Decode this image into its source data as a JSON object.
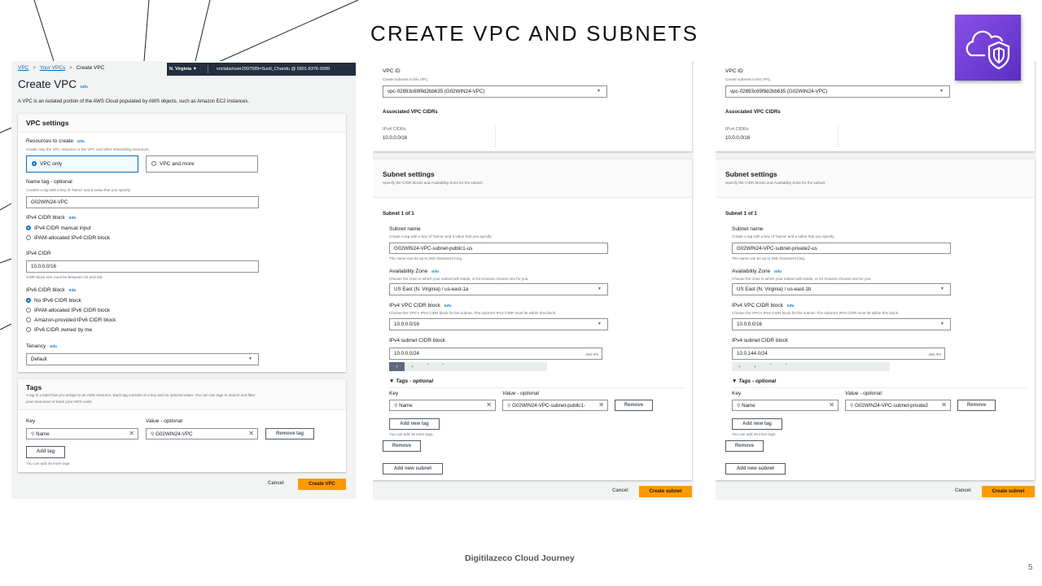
{
  "slide": {
    "title": "CREATE VPC AND SUBNETS",
    "footer": "Digitilazeco Cloud Journey",
    "page_number": "5",
    "logo_icon": "vpc-cloud-shield-icon",
    "accent": "#ff9900"
  },
  "vpc": {
    "breadcrumb": [
      "VPC",
      "Your VPCs",
      "Create VPC"
    ],
    "region": "N. Virginia ▼",
    "account": "voclabs/user2997589=Sunil_Chandu @ 5901-8376-9399",
    "title": "Create VPC",
    "info": "Info",
    "description": "A VPC is an isolated portion of the AWS Cloud populated by AWS objects, such as Amazon EC2 instances.",
    "settings_title": "VPC settings",
    "resources_label": "Resources to create",
    "resources_help": "Create only the VPC resource or the VPC and other networking resources.",
    "resource_options": [
      "VPC only",
      "VPC and more"
    ],
    "name_tag_label": "Name tag - optional",
    "name_tag_help": "Creates a tag with a key of 'Name' and a value that you specify.",
    "name_tag_value": "G02WIN24-VPC",
    "ipv4_block_label": "IPv4 CIDR block",
    "ipv4_block_options": [
      "IPv4 CIDR manual input",
      "IPAM-allocated IPv4 CIDR block"
    ],
    "ipv4_cidr_label": "IPv4 CIDR",
    "ipv4_cidr_value": "10.0.0.0/16",
    "ipv4_cidr_help": "CIDR block size must be between /16 and /28.",
    "ipv6_label": "IPv6 CIDR block",
    "ipv6_options": [
      "No IPv6 CIDR block",
      "IPAM-allocated IPv6 CIDR block",
      "Amazon-provided IPv6 CIDR block",
      "IPv6 CIDR owned by me"
    ],
    "tenancy_label": "Tenancy",
    "tenancy_value": "Default",
    "tags_title": "Tags",
    "tags_desc_1": "A tag is a label that you assign to an AWS resource. Each tag consists of a key and an optional value. You can use tags to search and filter",
    "tags_desc_2": "your resources or track your AWS costs.",
    "key_label": "Key",
    "value_label": "Value - optional",
    "tag_key": "Name",
    "tag_value": "G02WIN24-VPC",
    "remove_tag": "Remove tag",
    "add_tag": "Add tag",
    "tags_note": "You can add 49 more tags",
    "cancel": "Cancel",
    "create": "Create VPC"
  },
  "forms": [
    {
      "vpc_id_label": "VPC ID",
      "vpc_id_help": "Create subnets in this VPC.",
      "vpc_id_value": "vpc-02893c69f8d2bb635 (G02WIN24-VPC)",
      "assoc_title": "Associated VPC CIDRs",
      "ipv4_cidrs_label": "IPv4 CIDRs",
      "ipv4_cidrs_value": "10.0.0.0/16",
      "settings_title": "Subnet settings",
      "settings_desc": "Specify the CIDR blocks and Availability Zone for the subnet.",
      "subnet_count": "Subnet 1 of 1",
      "name_label": "Subnet name",
      "name_help": "Create a tag with a key of 'Name' and a value that you specify.",
      "name_value": "G02WIN24-VPC-subnet-public1-us",
      "name_note": "The name can be up to 256 characters long.",
      "az_label": "Availability Zone",
      "info": "Info",
      "az_help": "Choose the zone in which your subnet will reside, or let Amazon choose one for you.",
      "az_value": "US East (N. Virginia) / us-east-1a",
      "vpc_cidr_label": "IPv4 VPC CIDR block",
      "vpc_cidr_help": "Choose the VPC's IPv4 CIDR block for the subnet. The subnet's IPv4 CIDR must lie within this block.",
      "vpc_cidr_value": "10.0.0.0/16",
      "subnet_cidr_label": "IPv4 subnet CIDR block",
      "subnet_cidr_value": "10.0.0.0/24",
      "ip_count": "256 IPs",
      "tags_label": "▼ Tags - optional",
      "key_label": "Key",
      "value_label": "Value - optional",
      "tag_key": "Name",
      "tag_value": "G02WIN24-VPC-subnet-public1-",
      "remove_tag": "Remove",
      "add_tag": "Add new tag",
      "tags_note": "You can add 49 more tags.",
      "remove_subnet": "Remove",
      "add_subnet": "Add new subnet",
      "cancel": "Cancel",
      "create": "Create subnet"
    },
    {
      "vpc_id_label": "VPC ID",
      "vpc_id_help": "Create subnets in this VPC.",
      "vpc_id_value": "vpc-02893c69f8d2bb635 (G02WIN24-VPC)",
      "assoc_title": "Associated VPC CIDRs",
      "ipv4_cidrs_label": "IPv4 CIDRs",
      "ipv4_cidrs_value": "10.0.0.0/16",
      "settings_title": "Subnet settings",
      "settings_desc": "Specify the CIDR blocks and Availability Zone for the subnet.",
      "subnet_count": "Subnet 1 of 1",
      "name_label": "Subnet name",
      "name_help": "Create a tag with a key of 'Name' and a value that you specify.",
      "name_value": "G02WIN24-VPC-subnet-private2-us",
      "name_note": "The name can be up to 256 characters long.",
      "az_label": "Availability Zone",
      "info": "Info",
      "az_help": "Choose the zone in which your subnet will reside, or let Amazon choose one for you.",
      "az_value": "US East (N. Virginia) / us-east-1b",
      "vpc_cidr_label": "IPv4 VPC CIDR block",
      "vpc_cidr_help": "Choose the VPC's IPv4 CIDR block for the subnet. The subnet's IPv4 CIDR must lie within this block.",
      "vpc_cidr_value": "10.0.0.0/16",
      "subnet_cidr_label": "IPv4 subnet CIDR block",
      "subnet_cidr_value": "10.0.144.0/24",
      "ip_count": "256 IPs",
      "tags_label": "▼ Tags - optional",
      "key_label": "Key",
      "value_label": "Value - optional",
      "tag_key": "Name",
      "tag_value": "G02WIN24-VPC-subnet-private2",
      "remove_tag": "Remove",
      "add_tag": "Add new tag",
      "tags_note": "You can add 49 more tags.",
      "remove_subnet": "Remove",
      "add_subnet": "Add new subnet",
      "cancel": "Cancel",
      "create": "Create subnet"
    }
  ]
}
